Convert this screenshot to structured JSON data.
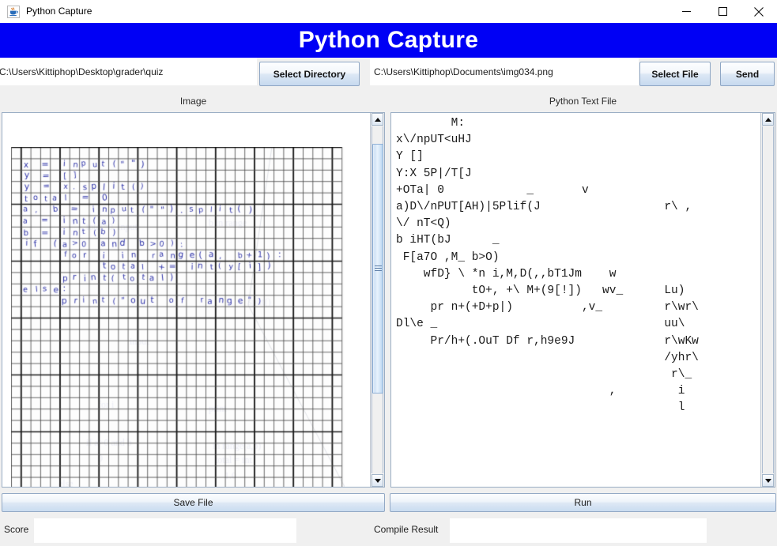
{
  "window": {
    "title": "Python Capture",
    "icon": "java-coffee-cup-icon",
    "controls": {
      "minimize": "minimize-icon",
      "maximize": "maximize-icon",
      "close": "close-icon"
    }
  },
  "banner": {
    "title": "Python Capture",
    "background_color": "#0000f5",
    "text_color": "#ffffff"
  },
  "toolbar": {
    "directory_path": "C:\\Users\\Kittiphop\\Desktop\\grader\\quiz",
    "directory_placeholder": "",
    "select_directory_label": "Select Directory",
    "file_path": "C:\\Users\\Kittiphop\\Documents\\img034.png",
    "file_placeholder": "",
    "select_file_label": "Select File",
    "send_label": "Send"
  },
  "panels": {
    "image_label": "Image",
    "text_label": "Python Text File"
  },
  "image_panel": {
    "scroll_thumb_top_pct": 5,
    "scroll_thumb_height_pct": 72,
    "handwritten_code": [
      "x = input(\"\")",
      "y = []",
      "y = x.split()",
      "total = 0",
      "a, b = input(\"\").split()",
      "a = int(a)",
      "b = int(b)",
      "if (a>0 and b>0):",
      "    for i in range(a, b+1):",
      "        total += int(y[i])",
      "    print(total)",
      "else:",
      "    print(\"out of range\")"
    ],
    "grid_columns": 34,
    "grid_rows": 30,
    "ink_color": "#2d32a8",
    "grid_line_color": "#1a1a1a"
  },
  "text_panel": {
    "content": "        M:\nx\\/npUT<uHJ\nY []\nY:X 5P|/T[J\n+OTa| 0            _       v\na)D\\/nPUT[AH)|5Plif(J                  r\\ ,\n\\/ nT<Q)\nb iHT(bJ      _\n F[a7O ,M_ b>O)\n    wfD} \\ *n i,M,D(,,bT1Jm    w\n           tO+, +\\ M+(9[!])   wv_      Lu)\n     pr n+(+D+p|)          ,v_         r\\wr\\\nDl\\e _                                 uu\\\n     Pr/h+(.OuT Df r,h9e9J             r\\wKw\n                                       /yhr\\\n                                        r\\_\n                               ,         i\n                                         l",
    "scroll_thumb_top_pct": 0,
    "scroll_thumb_height_pct": 100
  },
  "actions": {
    "save_file_label": "Save File",
    "run_label": "Run"
  },
  "status": {
    "score_label": "Score",
    "score_value": "",
    "compile_label": "Compile Result",
    "compile_value": ""
  }
}
